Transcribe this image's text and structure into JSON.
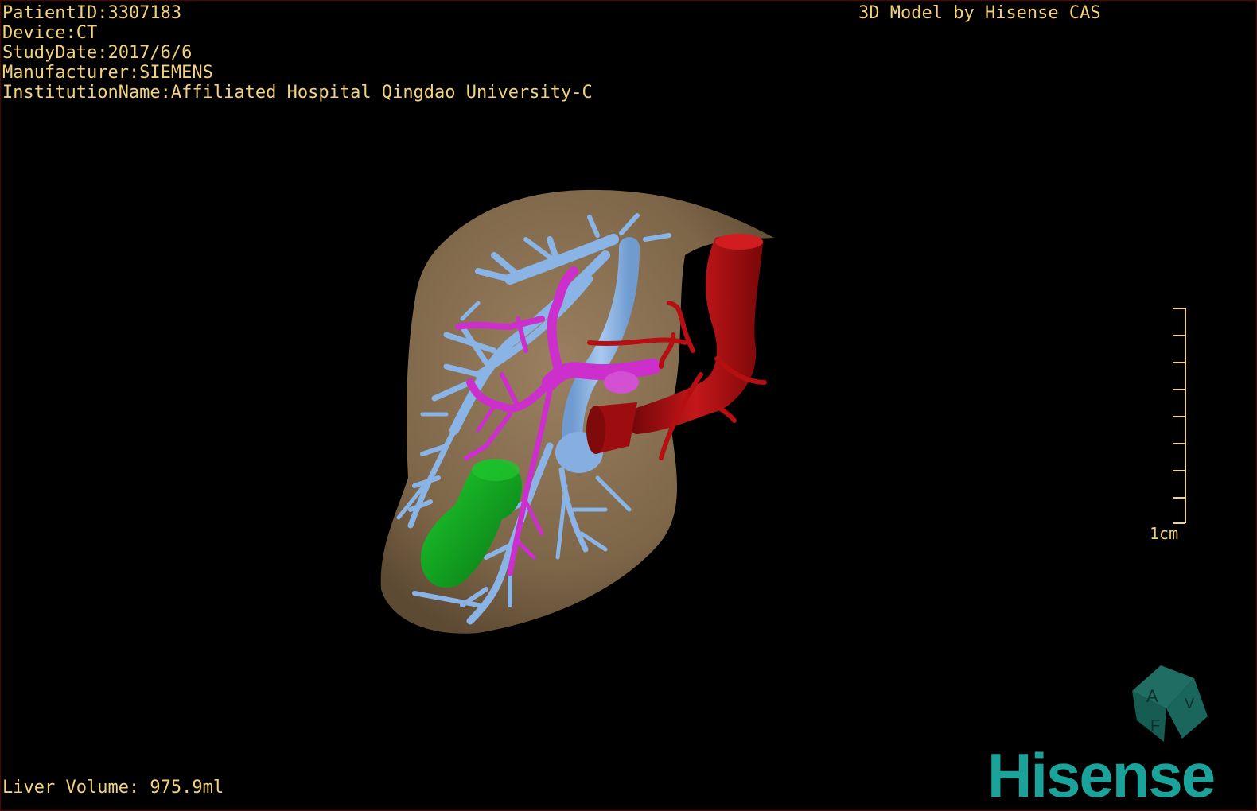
{
  "overlay": {
    "patient_id": "PatientID:3307183",
    "device": "Device:CT",
    "study_date": "StudyDate:2017/6/6",
    "manufacturer": "Manufacturer:SIEMENS",
    "institution": "InstitutionName:Affiliated Hospital Qingdao University-C",
    "brand_text": "3D Model by Hisense CAS",
    "liver_volume": "Liver Volume: 975.9ml"
  },
  "scale_bar": {
    "label": "1cm"
  },
  "orientation_cube": {
    "face_a": "A",
    "face_f": "F",
    "face_v": "V"
  },
  "logo": {
    "text": "Hisense"
  },
  "colors": {
    "overlay_text": "#f2d27a",
    "liver": "#8b7254",
    "portal_vein": "#8ab4e6",
    "hepatic_artery_branch": "#cc2fcc",
    "artery": "#b50f12",
    "lesion": "#0fa81e",
    "brand": "#1aa39a"
  }
}
